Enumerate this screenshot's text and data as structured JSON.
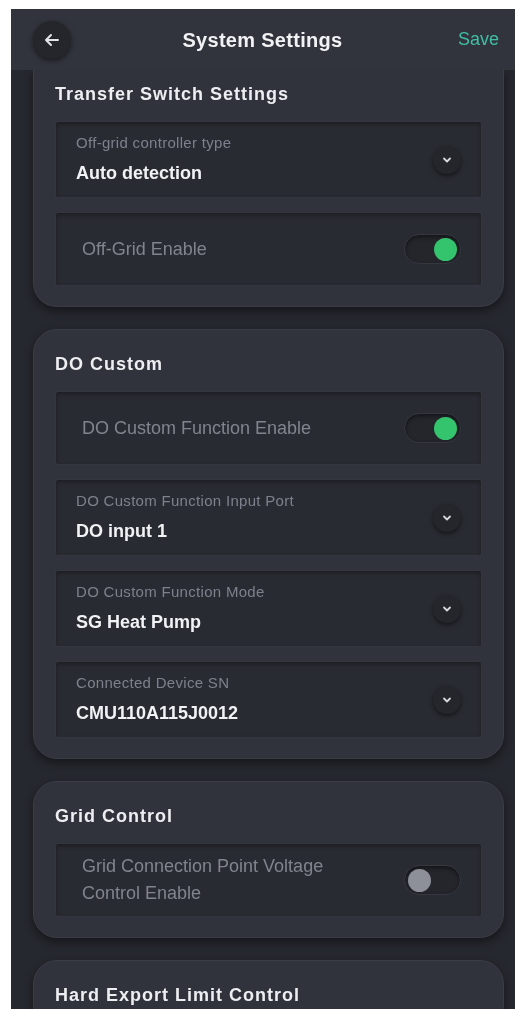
{
  "header": {
    "title": "System Settings",
    "action": "Save"
  },
  "sections": [
    {
      "title": "Transfer Switch Settings",
      "cut_top": true,
      "items": [
        {
          "kind": "select",
          "label": "Off-grid controller type",
          "value": "Auto detection"
        },
        {
          "kind": "toggle",
          "label": "Off-Grid Enable",
          "on": true
        }
      ]
    },
    {
      "title": "DO Custom",
      "cut_top": false,
      "items": [
        {
          "kind": "toggle",
          "label": "DO Custom Function Enable",
          "on": true
        },
        {
          "kind": "select",
          "label": "DO Custom Function Input Port",
          "value": "DO input 1"
        },
        {
          "kind": "select",
          "label": "DO Custom Function Mode",
          "value": "SG Heat Pump"
        },
        {
          "kind": "select",
          "label": "Connected Device SN",
          "value": "CMU110A115J0012"
        }
      ]
    },
    {
      "title": "Grid Control",
      "cut_top": false,
      "items": [
        {
          "kind": "toggle",
          "label": "Grid Connection Point Voltage Control Enable",
          "on": false
        }
      ]
    },
    {
      "title": "Hard Export Limit Control",
      "cut_top": false
    }
  ]
}
